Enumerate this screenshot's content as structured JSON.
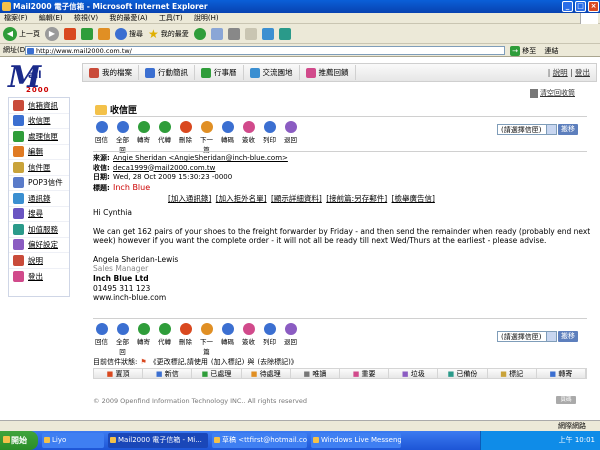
{
  "window": {
    "title": "Mail2000 電子信箱 - Microsoft Internet Explorer",
    "buttons": [
      "_",
      "□",
      "×"
    ]
  },
  "menu": [
    "檔案(F)",
    "編輯(E)",
    "檢視(V)",
    "我的最愛(A)",
    "工具(T)",
    "說明(H)"
  ],
  "toolbar": {
    "back": "上一頁",
    "search": "搜尋",
    "favorites": "我的最愛"
  },
  "address": {
    "label": "網址(D)",
    "url": "http://www.mail2000.com.tw/",
    "go": "移至",
    "links": "連結"
  },
  "logo": {
    "brand": "ail",
    "number": "2000"
  },
  "topnav": {
    "items": [
      "我的檔案",
      "行動簡訊",
      "行事曆",
      "交流園地",
      "推薦回饋"
    ],
    "help": "說明",
    "logout": "登出",
    "divider": "|"
  },
  "sidebar": {
    "items": [
      "信箱資訊",
      "收信匣",
      "處理信匣",
      "編輯",
      "信件匣",
      "POP3信件",
      "通訊錄",
      "搜尋",
      "加值服務",
      "偏好設定",
      "說明",
      "登出"
    ],
    "colors": [
      "#c94b3a",
      "#3b6fd1",
      "#2f9d3a",
      "#e07b24",
      "#c9a33a",
      "#5a7bc9",
      "#3b8fd1",
      "#6a55c2",
      "#2a9a8a",
      "#8b5cc2",
      "#c94b3a",
      "#d14a8b"
    ]
  },
  "inbox": {
    "title": "收信匣",
    "empty_trash": "清空回收筒"
  },
  "actions": {
    "labels": [
      "回信",
      "全部回",
      "轉寄",
      "代轉",
      "刪除",
      "下一篇",
      "轉碼",
      "簽收",
      "列印",
      "退回"
    ],
    "colors": [
      "#3b6fd1",
      "#3b6fd1",
      "#2f9d3a",
      "#2f9d3a",
      "#d9481f",
      "#e08f24",
      "#3b6fd1",
      "#d14a8b",
      "#3b6fd1",
      "#8b5cc2"
    ]
  },
  "folder_select": {
    "value": "(請選擇信匣)",
    "button": "搬移"
  },
  "message": {
    "from_label": "來源:",
    "from": "Angie Sheridan <AngieSheridan@inch-blue.com>",
    "to_label": "收信:",
    "to": "deca1999@mail2000.com.tw",
    "date_label": "日期:",
    "date": "Wed, 28 Oct 2009 15:30:23 -0000",
    "subject_label": "標題:",
    "subject": "Inch Blue",
    "links": [
      "[加入通訊錄]",
      "[加入拒外名單]",
      "[顯示詳細資料]",
      "[接前篇:另存郵件]",
      "[檢舉廣告信]"
    ],
    "greeting": "Hi Cynthia",
    "para1": "We can get 162 pairs of your shoes to the freight forwarder by Friday - and then send the remainder when ready (probably end next week) however if you want the complete order - it will not all be ready till next Wed/Thurs at the earliest - please advise.",
    "sig_name": "Angela Sheridan-Lewis",
    "sig_title": "Sales Manager",
    "sig_company": "Inch Blue Ltd",
    "sig_phone": "01495 311 123",
    "sig_web": "www.inch-blue.com"
  },
  "status_line": {
    "label": "目前信件狀態:",
    "text": "《更改標記,請使用",
    "add": "(加入標記)",
    "and": "與",
    "remove": "(去除標記)》"
  },
  "flags": [
    "置頂",
    "新信",
    "已處理",
    "待處理",
    "唯讀",
    "重要",
    "垃圾",
    "已備份",
    "標記",
    "轉寄"
  ],
  "flag_colors": [
    "#d9481f",
    "#3b6fd1",
    "#2f9d3a",
    "#e08f24",
    "#777777",
    "#d14a8b",
    "#8b5cc2",
    "#2a9a8a",
    "#c9a33a",
    "#3b6fd1"
  ],
  "copyright": "© 2009 Openfind Information Technology INC.. All rights reserved",
  "badge": "頁碼",
  "iestatus": {
    "right": "網際網路"
  },
  "taskbar": {
    "start": "開始",
    "items": [
      "Liyo",
      "Mail2000 電子信箱 - Mi...",
      "草稿 <ttfirst@hotmail.co...",
      "Windows Live Messenger"
    ],
    "clock": "上午 10:01"
  }
}
